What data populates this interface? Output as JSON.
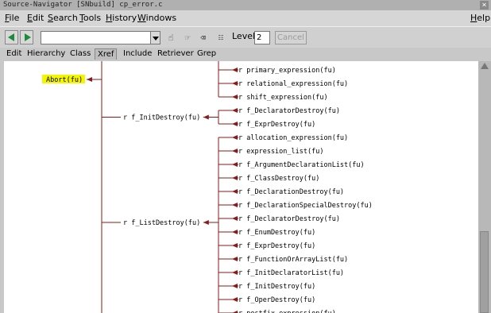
{
  "window": {
    "title": "Source-Navigator [SNbuild] cp_error.c"
  },
  "menubar": [
    {
      "u": "F",
      "rest": "ile"
    },
    {
      "u": "E",
      "rest": "dit"
    },
    {
      "u": "S",
      "rest": "earch"
    },
    {
      "u": "T",
      "rest": "ools"
    },
    {
      "u": "H",
      "rest": "istory"
    },
    {
      "u": "W",
      "rest": "indows"
    }
  ],
  "help": {
    "u": "H",
    "rest": "elp"
  },
  "toolbar": {
    "symbol_value": "",
    "levels_label": "Levels",
    "levels_value": "2",
    "cancel_label": "Cancel"
  },
  "tabs": [
    {
      "label": "Edit",
      "active": false
    },
    {
      "label": "Hierarchy",
      "active": false
    },
    {
      "label": "Class",
      "active": false
    },
    {
      "label": "Xref",
      "active": true
    },
    {
      "label": "Include",
      "active": false
    },
    {
      "label": "Retriever",
      "active": false
    },
    {
      "label": "Grep",
      "active": false
    }
  ],
  "xref": {
    "root": "Abort(fu)",
    "colors": {
      "line": "#8b1a1a",
      "highlight": "#f5f500"
    },
    "top_refs": [
      "r primary_expression(fu)",
      "r relational_expression(fu)",
      "r shift_expression(fu)"
    ],
    "parents": [
      {
        "label": "r f_InitDestroy(fu)",
        "refs": [
          "r f_DeclaratorDestroy(fu)",
          "r f_ExprDestroy(fu)"
        ]
      },
      {
        "label": "r f_ListDestroy(fu)",
        "refs": [
          "r allocation_expression(fu)",
          "r expression_list(fu)",
          "r f_ArgumentDeclarationList(fu)",
          "r f_ClassDestroy(fu)",
          "r f_DeclarationDestroy(fu)",
          "r f_DeclarationSpecialDestroy(fu)",
          "r f_DeclaratorDestroy(fu)",
          "r f_EnumDestroy(fu)",
          "r f_ExprDestroy(fu)",
          "r f_FunctionOrArrayList(fu)",
          "r f_InitDeclaratorList(fu)",
          "r f_InitDestroy(fu)",
          "r f_OperDestroy(fu)",
          "r postfix_expression(fu)"
        ]
      }
    ]
  }
}
